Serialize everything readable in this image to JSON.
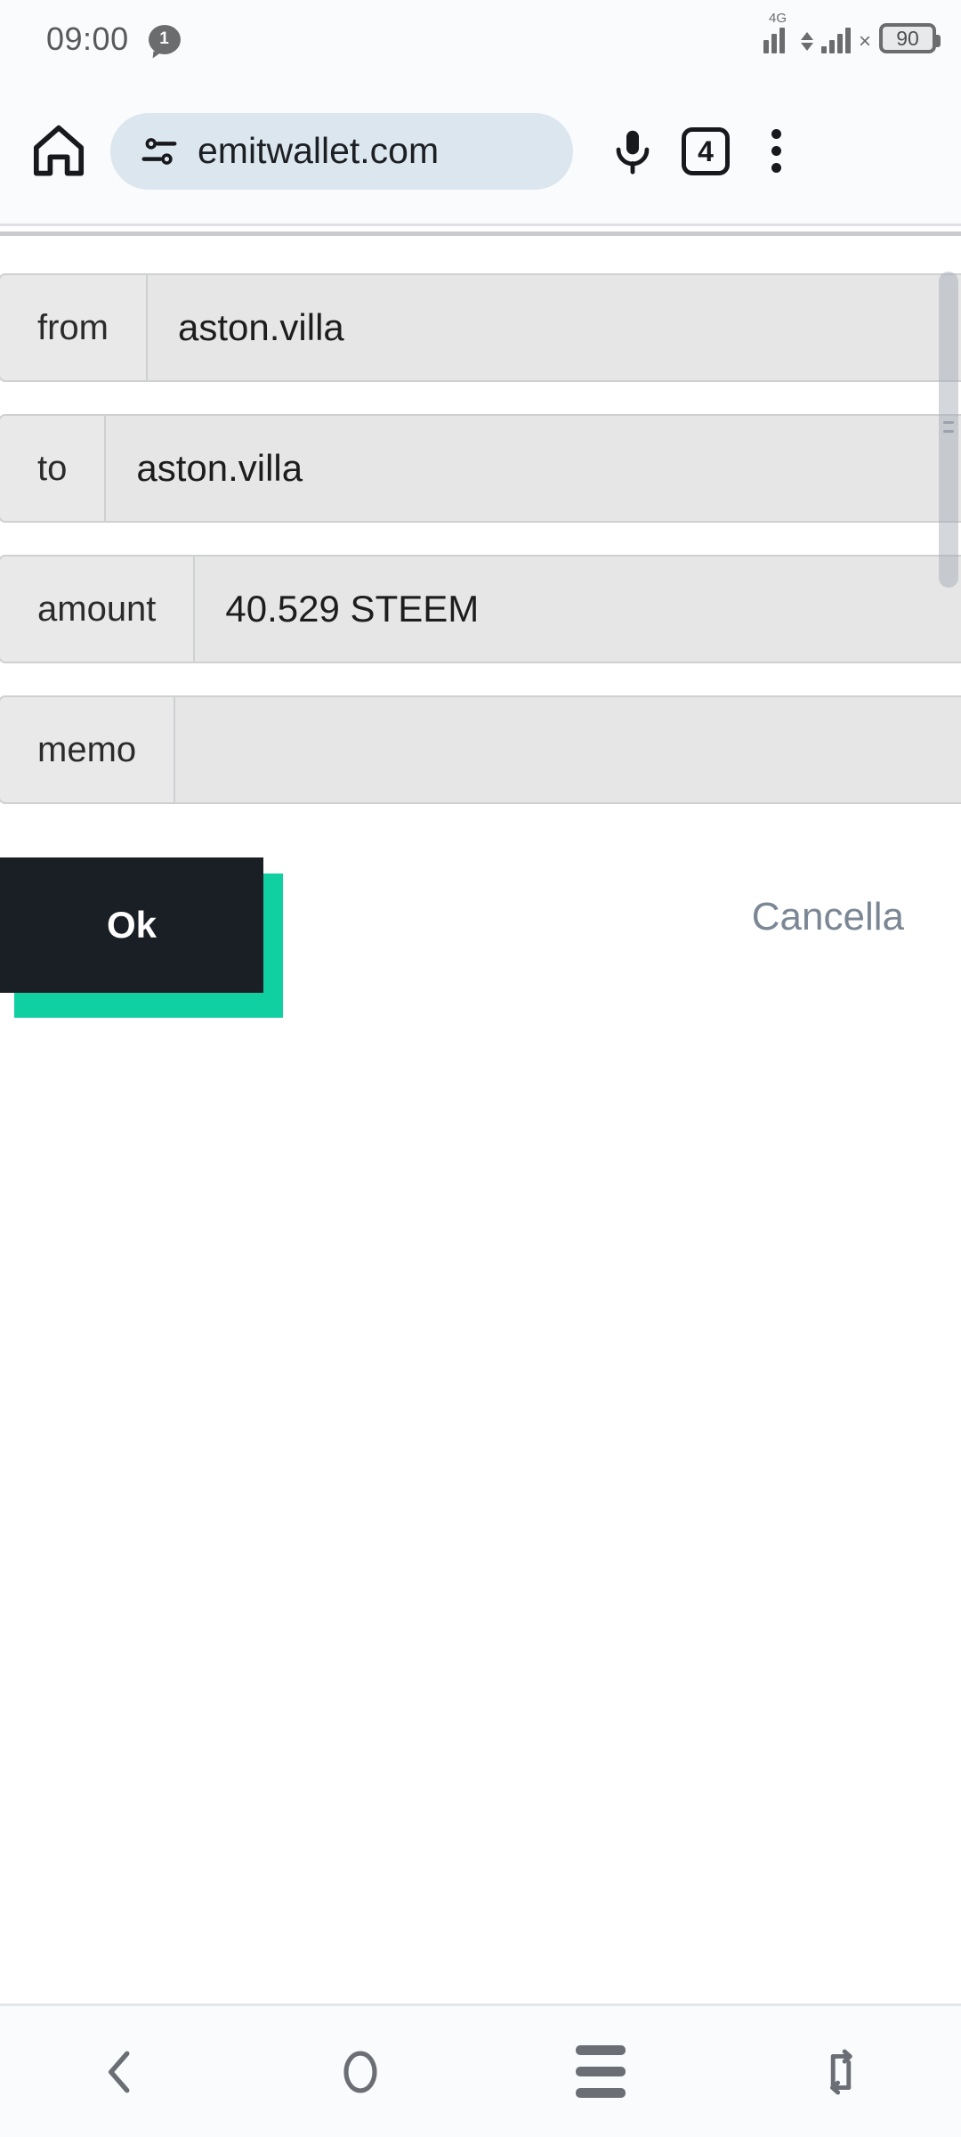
{
  "statusbar": {
    "time": "09:00",
    "notification_count": "1",
    "network_label": "4G",
    "battery_level": "90",
    "sim_x_mark": "×",
    "icons": [
      "notification-bubble-icon",
      "signal-bars-4g-icon",
      "data-transfer-icon",
      "signal-bars-secondary-icon",
      "no-sim-x-icon",
      "battery-icon"
    ]
  },
  "browser": {
    "url": "emitwallet.com",
    "tab_count": "4",
    "icons": [
      "home-icon",
      "tune-icon",
      "microphone-icon",
      "tab-counter-icon",
      "overflow-menu-icon"
    ]
  },
  "form": {
    "fields": [
      {
        "label": "from",
        "value": "aston.villa",
        "placeholder": ""
      },
      {
        "label": "to",
        "value": "aston.villa",
        "placeholder": ""
      },
      {
        "label": "amount",
        "value": "40.529 STEEM",
        "placeholder": ""
      },
      {
        "label": "memo",
        "value": "",
        "placeholder": ""
      }
    ]
  },
  "actions": {
    "ok_label": "Ok",
    "cancel_label": "Cancella",
    "ok_bg": "#1a1f26",
    "ok_shadow": "#10cfa1",
    "cancel_color": "#7b8794"
  },
  "navbar": {
    "back_label": "Back",
    "home_label": "Home",
    "recents_label": "Recents",
    "rotate_label": "Rotate screen",
    "icons": [
      "back-chevron-icon",
      "home-circle-icon",
      "recents-hamburger-icon",
      "rotate-screen-icon"
    ]
  }
}
